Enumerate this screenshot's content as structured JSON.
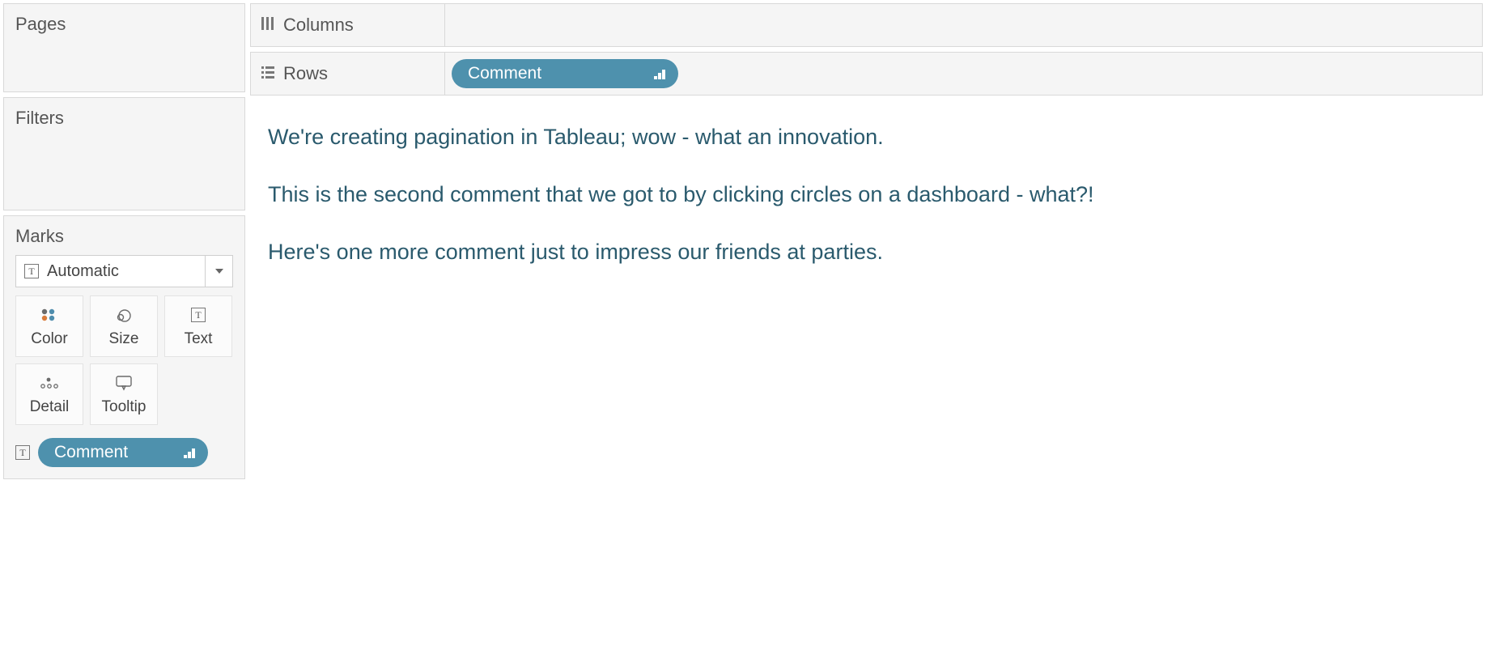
{
  "panels": {
    "pages": "Pages",
    "filters": "Filters",
    "marks": "Marks"
  },
  "shelves": {
    "columns_label": "Columns",
    "rows_label": "Rows",
    "rows_pill": "Comment"
  },
  "marks": {
    "type": "Automatic",
    "buttons": {
      "color": "Color",
      "size": "Size",
      "text": "Text",
      "detail": "Detail",
      "tooltip": "Tooltip"
    },
    "text_pill": "Comment"
  },
  "viz": {
    "rows": [
      "We're creating pagination in Tableau; wow - what an innovation.",
      "This is the second comment that we got to by clicking circles on a dashboard - what?!",
      "Here's one more comment just to impress our friends at parties."
    ]
  }
}
